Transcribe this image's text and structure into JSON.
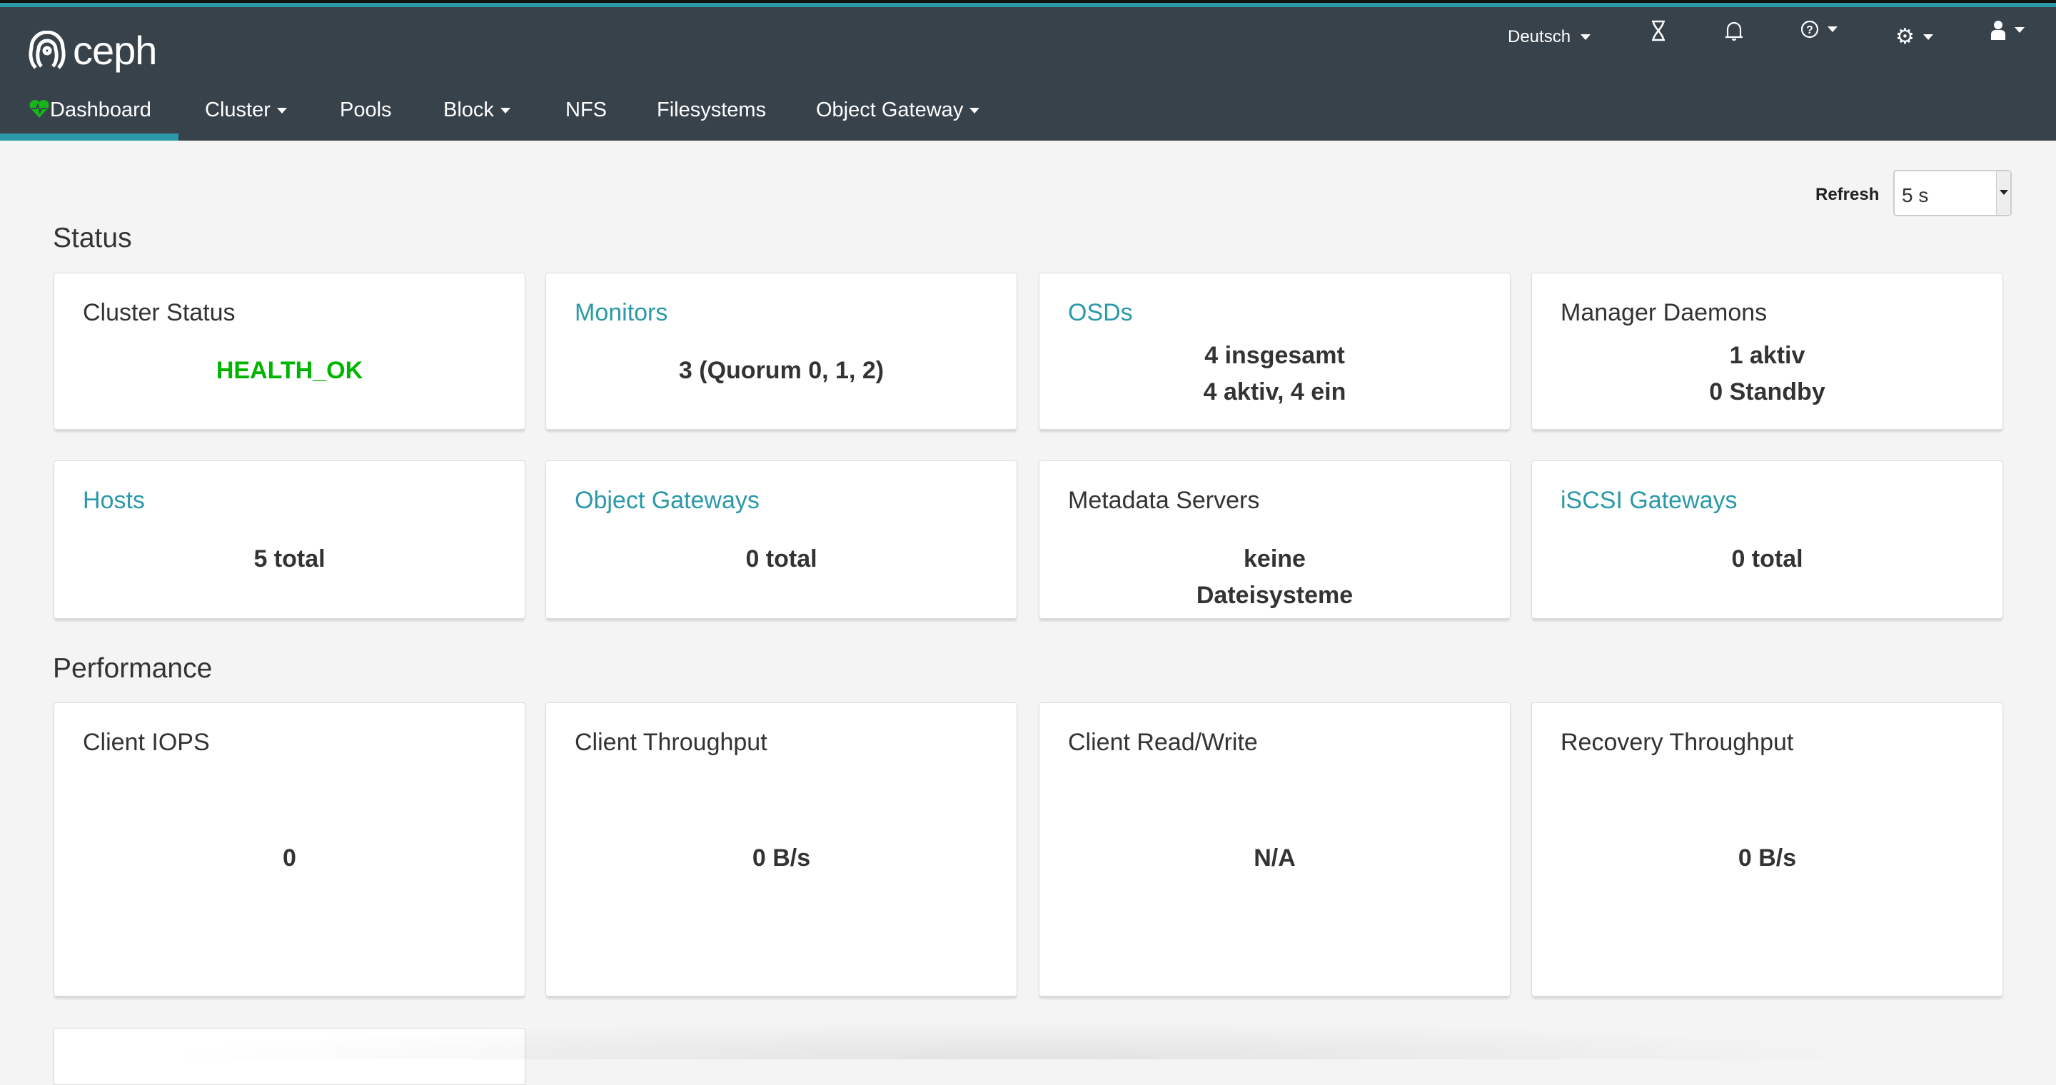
{
  "brand": {
    "name": "ceph",
    "accent": "#2b99a8",
    "header_bg": "#37424a",
    "health_color": "#00b500"
  },
  "nav": [
    {
      "label": "Dashboard",
      "icon": "heartbeat-icon",
      "active": true
    },
    {
      "label": "Cluster",
      "dropdown": true
    },
    {
      "label": "Pools"
    },
    {
      "label": "Block",
      "dropdown": true
    },
    {
      "label": "NFS"
    },
    {
      "label": "Filesystems"
    },
    {
      "label": "Object Gateway",
      "dropdown": true
    }
  ],
  "toolbar": {
    "language": "Deutsch",
    "icons": [
      "hourglass-icon",
      "bell-icon",
      "help-icon",
      "gear-icon",
      "user-icon"
    ]
  },
  "refresh": {
    "label": "Refresh",
    "value": "5 s"
  },
  "status": {
    "heading": "Status",
    "cards": [
      {
        "title": "Cluster Status",
        "values": [
          "HEALTH_OK"
        ]
      },
      {
        "title": "Monitors",
        "values": [
          "3 (Quorum 0, 1, 2)"
        ]
      },
      {
        "title": "OSDs",
        "values": [
          "4 insgesamt",
          "4 aktiv, 4 ein"
        ]
      },
      {
        "title": "Manager Daemons",
        "values": [
          "1 aktiv",
          "0 Standby"
        ]
      },
      {
        "title": "Hosts",
        "values": [
          "5 total"
        ]
      },
      {
        "title": "Object Gateways",
        "values": [
          "0 total"
        ]
      },
      {
        "title": "Metadata Servers",
        "values": [
          "keine",
          "Dateisysteme"
        ]
      },
      {
        "title": "iSCSI Gateways",
        "values": [
          "0 total"
        ]
      }
    ]
  },
  "performance": {
    "heading": "Performance",
    "cards": [
      {
        "title": "Client IOPS",
        "value": "0"
      },
      {
        "title": "Client Throughput",
        "value": "0 B/s"
      },
      {
        "title": "Client Read/Write",
        "value": "N/A"
      },
      {
        "title": "Recovery Throughput",
        "value": "0 B/s"
      }
    ]
  }
}
